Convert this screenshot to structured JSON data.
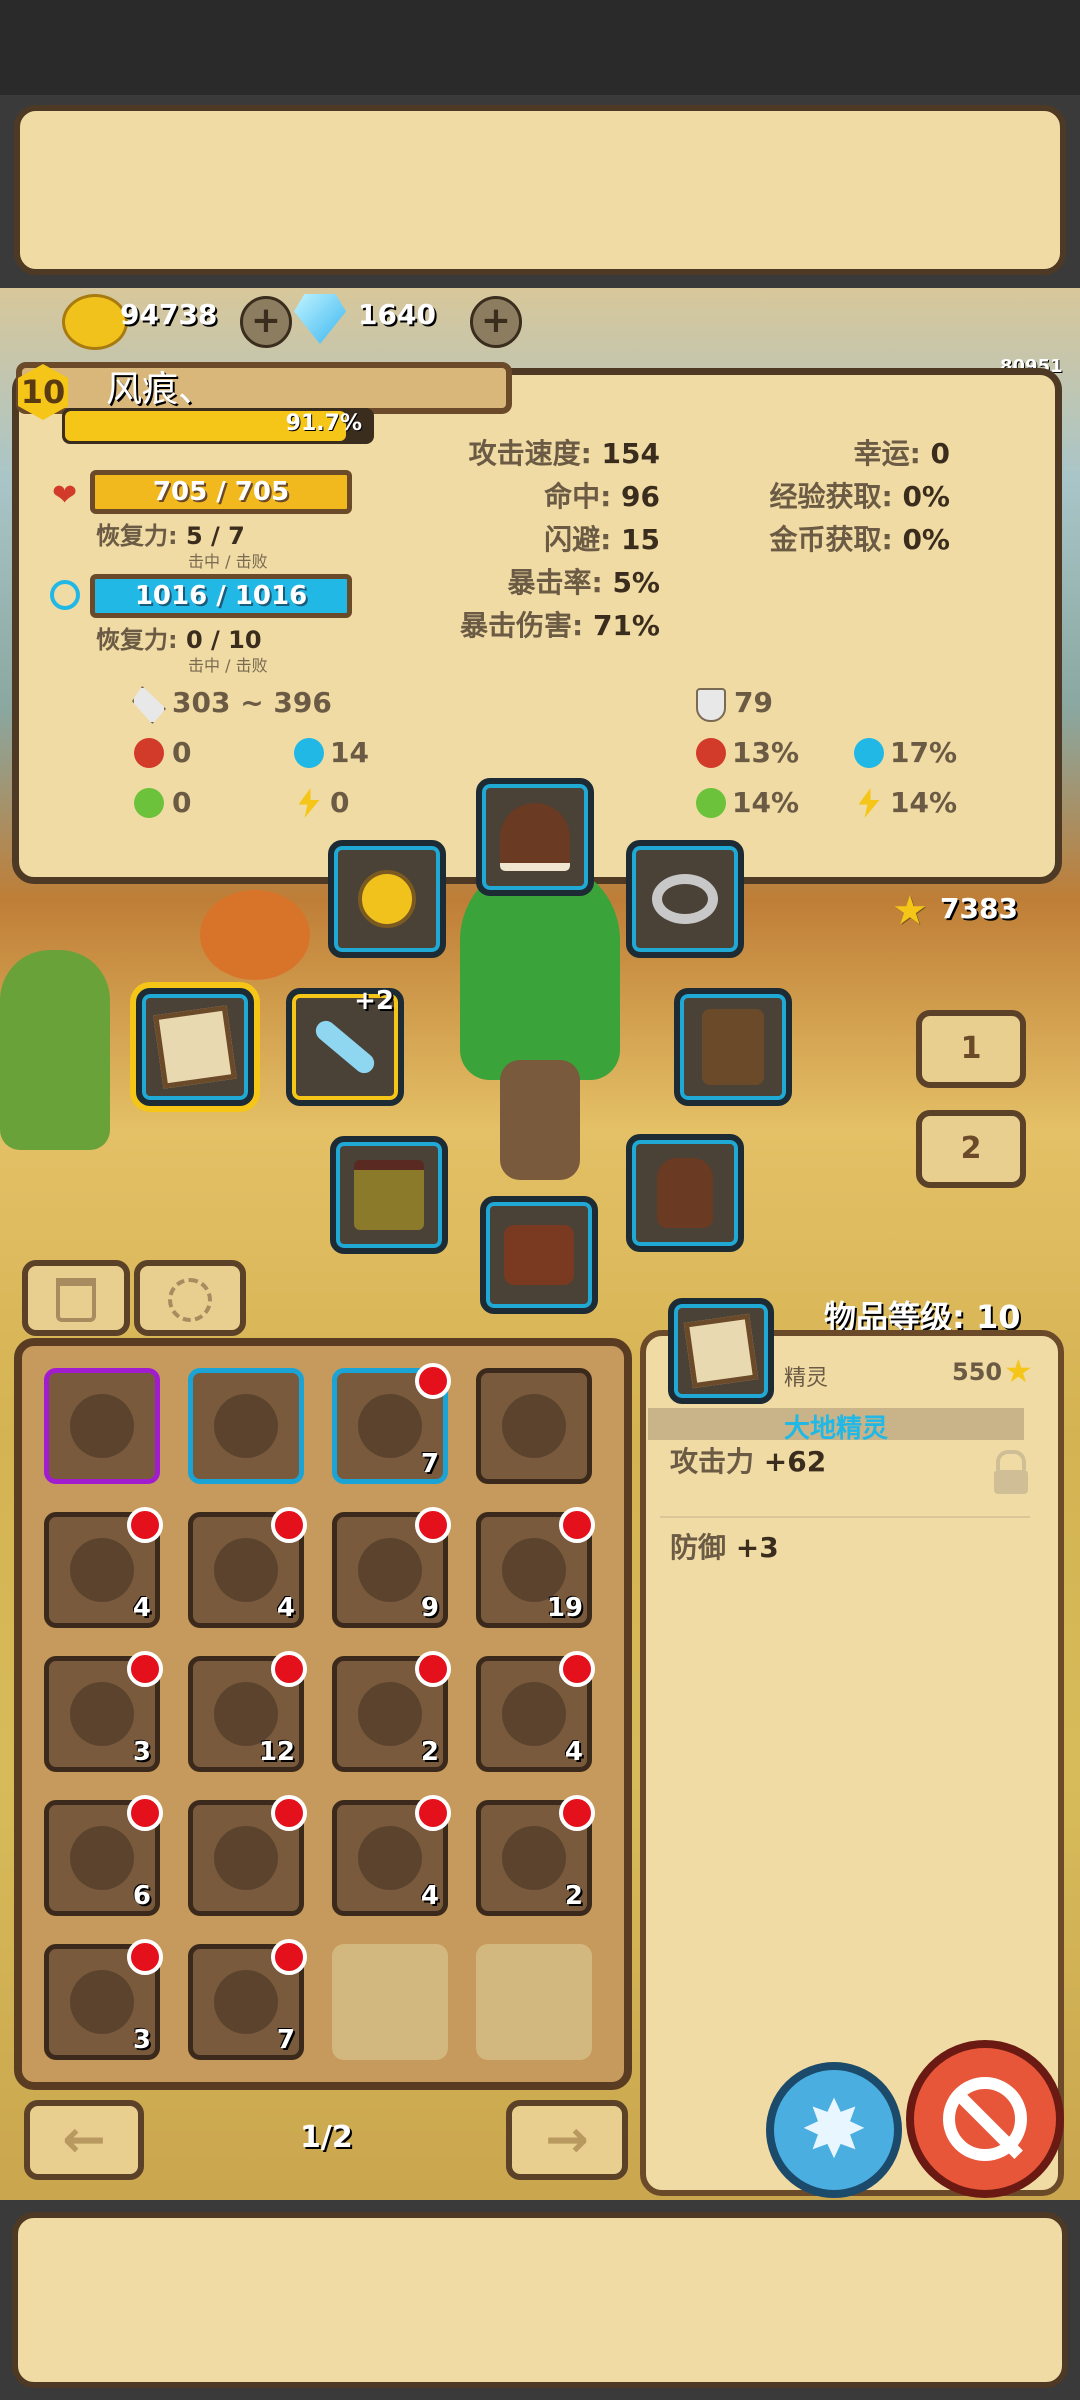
{
  "currency": {
    "gold": "94738",
    "gems": "1640",
    "plus": "+"
  },
  "player": {
    "level": "10",
    "name": "风痕、",
    "exp_percent": "91.7%",
    "exp_fraction": 0.917,
    "id": "80951"
  },
  "hp": {
    "value": "705 / 705",
    "regen_label": "恢复力:",
    "regen_value": "5 / 7",
    "regen_sub": "击中 / 击败"
  },
  "mp": {
    "value": "1016 / 1016",
    "regen_label": "恢复力:",
    "regen_value": "0 / 10",
    "regen_sub": "击中 / 击败"
  },
  "stats_left": [
    {
      "label": "攻击速度:",
      "value": "154"
    },
    {
      "label": "命中:",
      "value": "96"
    },
    {
      "label": "闪避:",
      "value": "15"
    },
    {
      "label": "暴击率:",
      "value": "5%"
    },
    {
      "label": "暴击伤害:",
      "value": "71%"
    }
  ],
  "stats_right": [
    {
      "label": "幸运:",
      "value": "0"
    },
    {
      "label": "经验获取:",
      "value": "0%"
    },
    {
      "label": "金币获取:",
      "value": "0%"
    }
  ],
  "combat": {
    "damage": "303 ~ 396",
    "armor": "79",
    "fire_atk": "0",
    "ice_atk": "14",
    "poison_atk": "0",
    "lightning_atk": "0",
    "fire_res": "13%",
    "ice_res": "17%",
    "poison_res": "14%",
    "lightning_res": "14%"
  },
  "equipment": {
    "weapon_plus": "+2",
    "star_points": "7383"
  },
  "tabs": {
    "tab1": "1",
    "tab2": "2"
  },
  "inventory": {
    "page": "1/2",
    "items": [
      {
        "name": "staff",
        "count": "",
        "badge": false,
        "frame": "#a21ccf"
      },
      {
        "name": "green-orb",
        "count": "",
        "badge": false,
        "frame": "#1aa4d6"
      },
      {
        "name": "gem",
        "count": "7",
        "badge": true,
        "frame": "#1aa4d6"
      },
      {
        "name": "potion",
        "count": "",
        "badge": false,
        "frame": "#3b2a1b"
      },
      {
        "name": "key",
        "count": "4",
        "badge": true,
        "frame": "#3b2a1b"
      },
      {
        "name": "purple-orb",
        "count": "4",
        "badge": true,
        "frame": "#3b2a1b"
      },
      {
        "name": "ice-armor",
        "count": "9",
        "badge": true,
        "frame": "#3b2a1b"
      },
      {
        "name": "crystal-ore",
        "count": "19",
        "badge": true,
        "frame": "#3b2a1b"
      },
      {
        "name": "lantern",
        "count": "3",
        "badge": true,
        "frame": "#3b2a1b"
      },
      {
        "name": "stick",
        "count": "12",
        "badge": true,
        "frame": "#3b2a1b"
      },
      {
        "name": "stone-plates",
        "count": "2",
        "badge": true,
        "frame": "#3b2a1b"
      },
      {
        "name": "ruby-amulet",
        "count": "4",
        "badge": true,
        "frame": "#3b2a1b"
      },
      {
        "name": "hooded-figure",
        "count": "6",
        "badge": true,
        "frame": "#3b2a1b"
      },
      {
        "name": "fur",
        "count": "",
        "badge": true,
        "frame": "#3b2a1b"
      },
      {
        "name": "horn",
        "count": "4",
        "badge": true,
        "frame": "#3b2a1b"
      },
      {
        "name": "powder-pile",
        "count": "2",
        "badge": true,
        "frame": "#3b2a1b"
      },
      {
        "name": "red-pile",
        "count": "3",
        "badge": true,
        "frame": "#3b2a1b"
      },
      {
        "name": "claw",
        "count": "7",
        "badge": true,
        "frame": "#3b2a1b"
      }
    ]
  },
  "detail": {
    "item_level_label": "物品等级:",
    "item_level": "10",
    "type": "精灵",
    "price": "550",
    "name": "大地精灵",
    "attack_label": "攻击力",
    "attack_value": "+62",
    "defense_label": "防御",
    "defense_value": "+3"
  },
  "colors": {
    "hp": "#f2b91e",
    "mp": "#22b8e6",
    "badge": "#e4101c",
    "highlight": "#f5c518"
  }
}
